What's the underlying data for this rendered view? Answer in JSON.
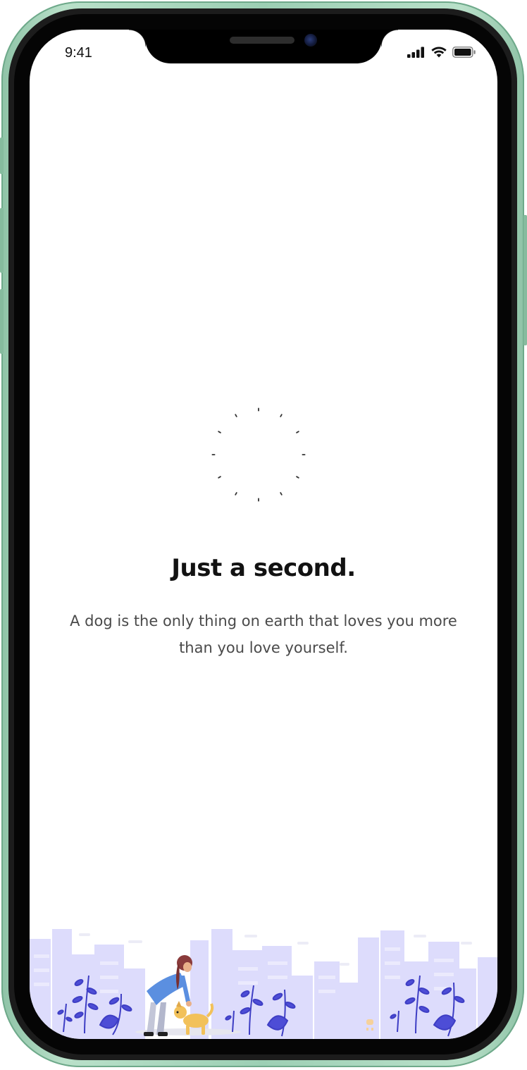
{
  "status_bar": {
    "time": "9:41",
    "icons": [
      "signal-icon",
      "wifi-icon",
      "battery-icon"
    ]
  },
  "loading": {
    "title": "Just a second.",
    "message": "A dog is the only thing on earth that loves you more than you love yourself."
  },
  "illustration": "person-petting-dog-city-skyline",
  "colors": {
    "frame": "#9ccfb4",
    "buildings": "#d6d4fb",
    "plants": "#4f4fd8",
    "dog": "#f2c15a",
    "shirt": "#5b8fe0"
  }
}
